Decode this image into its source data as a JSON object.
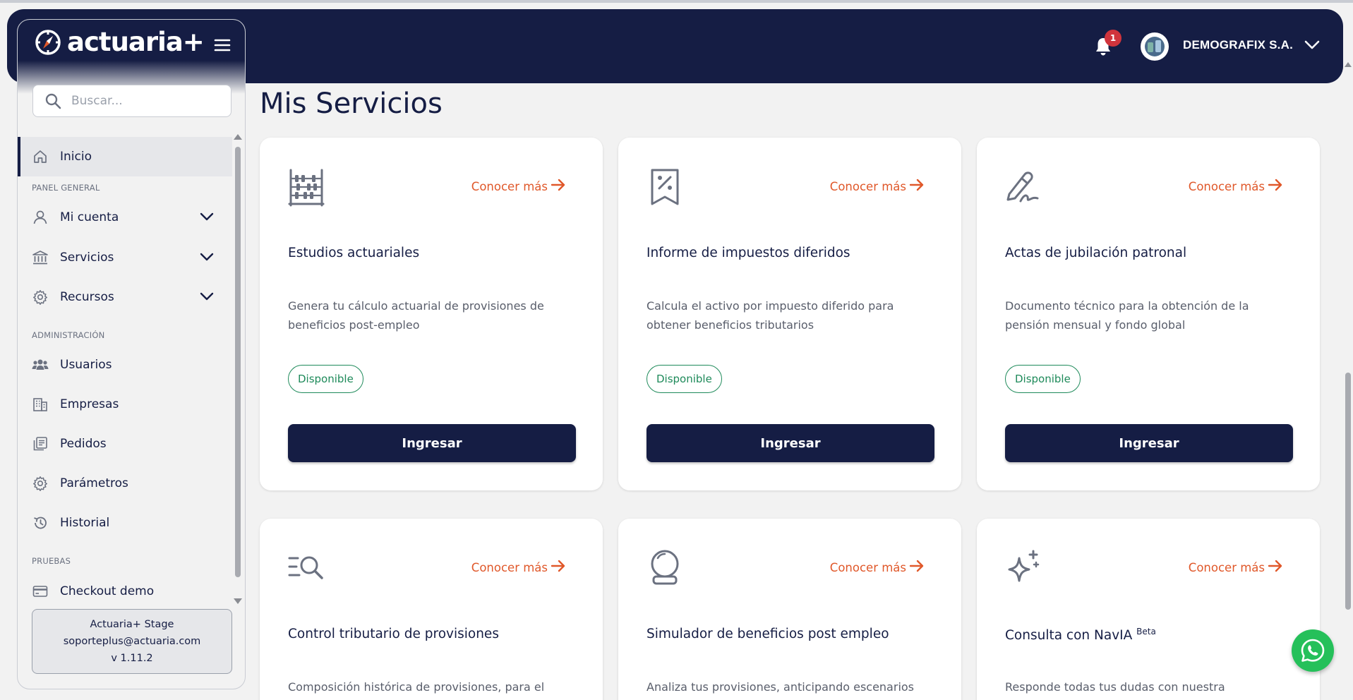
{
  "header": {
    "notifications_count": "1",
    "company_name": "DEMOGRAFIX S.A."
  },
  "sidebar": {
    "logo_text": "actuaria+",
    "search_placeholder": "Buscar...",
    "items": {
      "inicio": "Inicio",
      "mi_cuenta": "Mi cuenta",
      "servicios": "Servicios",
      "recursos": "Recursos",
      "usuarios": "Usuarios",
      "empresas": "Empresas",
      "pedidos": "Pedidos",
      "parametros": "Parámetros",
      "historial": "Historial",
      "checkout_demo": "Checkout demo"
    },
    "sections": {
      "panel_general": "PANEL GENERAL",
      "administracion": "ADMINISTRACIÓN",
      "pruebas": "PRUEBAS"
    },
    "env_info": {
      "name": "Actuaria+ Stage",
      "email": "soporteplus@actuaria.com",
      "version": "v 1.11.2"
    }
  },
  "main": {
    "page_title": "Mis Servicios",
    "learn_more_label": "Conocer más",
    "cards": [
      {
        "icon": "abacus-icon",
        "title": "Estudios actuariales",
        "description": "Genera tu cálculo actuarial de provisiones de beneficios post-empleo",
        "status": "Disponible",
        "button": "Ingresar"
      },
      {
        "icon": "tax-receipt-icon",
        "title": "Informe de impuestos diferidos",
        "description": "Calcula el activo por impuesto diferido para obtener beneficios tributarios",
        "status": "Disponible",
        "button": "Ingresar"
      },
      {
        "icon": "signature-icon",
        "title": "Actas de jubilación patronal",
        "description": "Documento técnico para la obtención de la pensión mensual y fondo global",
        "status": "Disponible",
        "button": "Ingresar"
      },
      {
        "icon": "list-search-icon",
        "title": "Control tributario de provisiones",
        "description": "Composición histórica de provisiones, para el",
        "status": "",
        "button": ""
      },
      {
        "icon": "crystal-ball-icon",
        "title": "Simulador de beneficios post empleo",
        "description": "Analiza tus provisiones, anticipando escenarios",
        "status": "",
        "button": ""
      },
      {
        "icon": "sparkles-icon",
        "title": "Consulta con NavIA",
        "title_sup": "Beta",
        "description": "Responde todas tus dudas con nuestra inteligencia",
        "status": "",
        "button": ""
      }
    ]
  },
  "colors": {
    "brand_navy": "#151d44",
    "accent_orange": "#e0582a",
    "status_green": "#1e8a5a",
    "badge_red": "#d0343c",
    "whatsapp_green": "#25c05a"
  }
}
